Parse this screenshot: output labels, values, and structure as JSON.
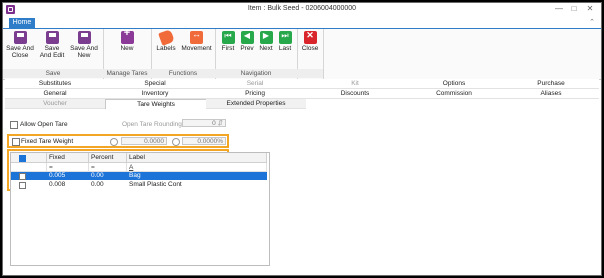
{
  "window": {
    "title": "Item : Bulk Seed - 0206004000000",
    "minimize_glyph": "—",
    "maximize_glyph": "□",
    "close_glyph": "✕",
    "collapse_glyph": "⌃"
  },
  "ribbon": {
    "tab": "Home",
    "groups": {
      "save": {
        "label": "Save",
        "buttons": [
          "Save And Close",
          "Save And Edit",
          "Save And New"
        ]
      },
      "manage_tares": {
        "label": "Manage Tares",
        "buttons": [
          "New"
        ]
      },
      "functions": {
        "label": "Functions",
        "buttons": [
          "Labels",
          "Movement"
        ]
      },
      "navigation": {
        "label": "Navigation",
        "buttons": [
          "First",
          "Prev",
          "Next",
          "Last"
        ]
      },
      "close": {
        "label": "",
        "buttons": [
          "Close"
        ]
      }
    },
    "save_lines": {
      "save_close": [
        "Save And",
        "Close"
      ],
      "save_edit": [
        "Save",
        "And Edit"
      ],
      "save_new": [
        "Save And",
        "New"
      ]
    },
    "icons": {
      "save": "floppy-disk-icon",
      "new": "new-tare-icon",
      "labels": "tag-icon",
      "movement": "movement-arrows-icon",
      "first": "first-record-icon",
      "prev": "previous-record-icon",
      "next": "next-record-icon",
      "last": "last-record-icon",
      "close": "close-x-icon"
    }
  },
  "section_tabs": {
    "row1": [
      "Substitutes",
      "Special",
      "Serial",
      "Kit",
      "Options",
      "Purchase"
    ],
    "row2": [
      "General",
      "Inventory",
      "Pricing",
      "Discounts",
      "Commission",
      "Aliases"
    ],
    "row3": [
      "Voucher",
      "Tare Weights",
      "Extended Properties"
    ],
    "active": "Tare Weights"
  },
  "tare_weights": {
    "allow_open_tare": "Allow Open Tare",
    "open_tare_rounding_label": "Open Tare Rounding :",
    "open_tare_rounding_value": "0",
    "fixed_tare_weight": "Fixed Tare Weight",
    "fixed_value": "0.0000",
    "fixed_percent": "0.0000%",
    "grid": {
      "columns": [
        "Fixed",
        "Percent",
        "Label"
      ],
      "filter_glyphs": [
        "=",
        "=",
        "A"
      ],
      "rows": [
        {
          "fixed": "0.005",
          "percent": "0.00",
          "label": "Bag",
          "selected": true
        },
        {
          "fixed": "0.008",
          "percent": "0.00",
          "label": "Small Plastic Cont",
          "selected": false
        }
      ]
    }
  },
  "colors": {
    "accent_blue": "#2f7cc9",
    "selection_blue": "#1c74d8",
    "highlight_orange": "#f2a623",
    "nav_green": "#27a84a",
    "close_red": "#d9262d",
    "purple": "#7b3d8f"
  }
}
